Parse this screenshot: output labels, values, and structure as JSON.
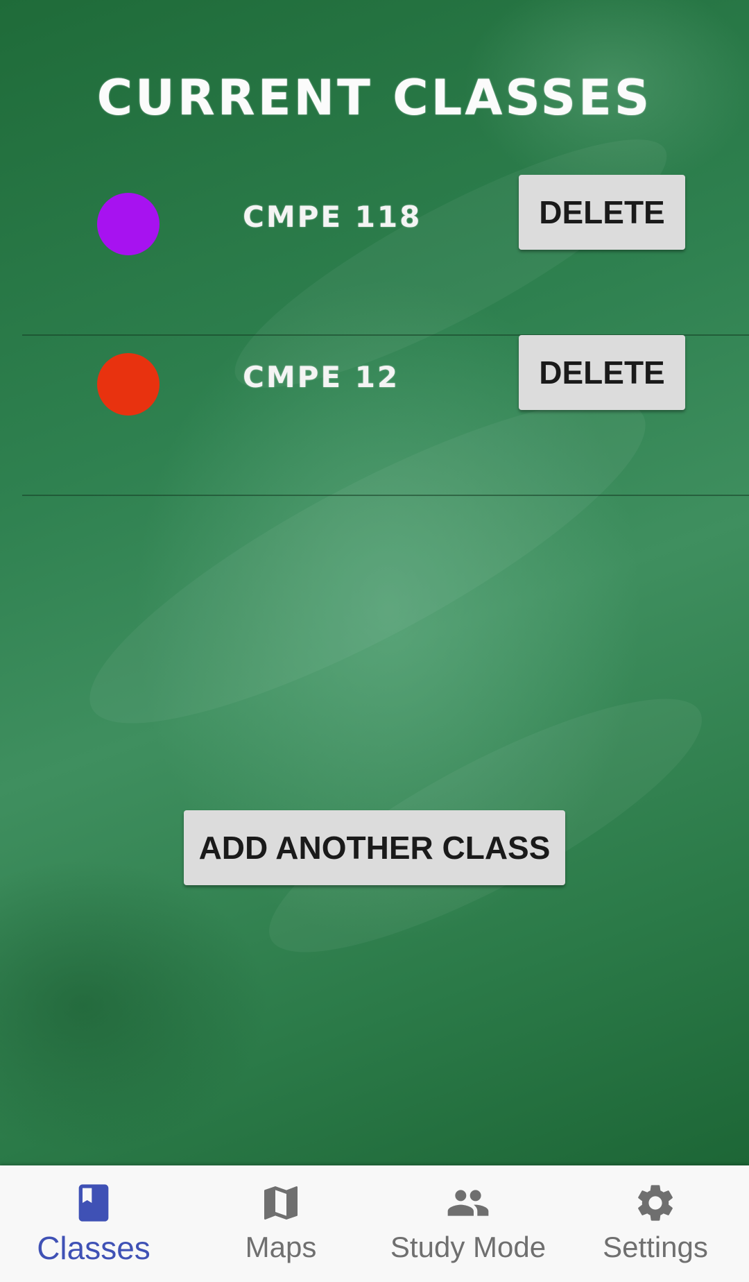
{
  "header": {
    "title": "CURRENT CLASSES"
  },
  "classes": [
    {
      "name": "CMPE 118",
      "color": "#a712f0",
      "delete_label": "DELETE"
    },
    {
      "name": "CMPE 12",
      "color": "#e8320f",
      "delete_label": "DELETE"
    }
  ],
  "actions": {
    "add_label": "ADD ANOTHER CLASS"
  },
  "nav": {
    "active_color": "#3f51b5",
    "items": [
      {
        "label": "Classes",
        "icon": "book-icon",
        "active": true
      },
      {
        "label": "Maps",
        "icon": "map-icon",
        "active": false
      },
      {
        "label": "Study Mode",
        "icon": "group-icon",
        "active": false
      },
      {
        "label": "Settings",
        "icon": "gear-icon",
        "active": false
      }
    ]
  }
}
